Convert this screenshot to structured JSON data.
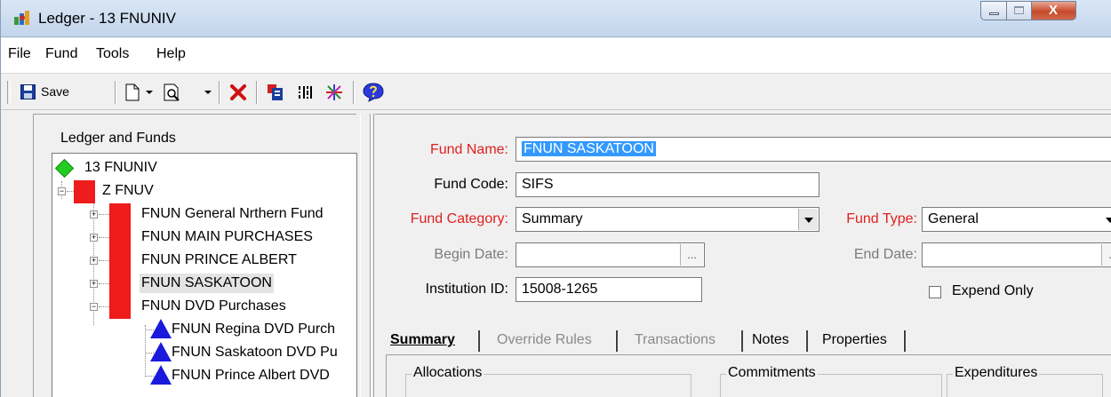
{
  "window": {
    "title": "Ledger - 13 FNUNIV",
    "close_glyph": "X"
  },
  "menu": {
    "items": [
      "File",
      "Fund",
      "Tools",
      "Help"
    ]
  },
  "toolbar": {
    "save_label": "Save",
    "icons": [
      "save-icon",
      "new-document-icon",
      "print-preview-icon",
      "delete-icon",
      "report-icon",
      "barcode-icon",
      "asterisk-icon",
      "help-icon"
    ]
  },
  "tree": {
    "header": "Ledger and Funds",
    "root": "13 FNUNIV",
    "ledger": "Z FNUV",
    "funds": [
      "FNUN General Nrthern Fund",
      "FNUN MAIN PURCHASES",
      "FNUN PRINCE ALBERT",
      "FNUN SASKATOON",
      "FNUN DVD Purchases"
    ],
    "subfunds": [
      "FNUN Regina DVD Purch",
      "FNUN Saskatoon DVD Pu",
      "FNUN Prince Albert DVD"
    ],
    "expand_glyph": "+",
    "collapse_glyph": "−"
  },
  "form": {
    "fund_name_label": "Fund Name:",
    "fund_name_value": "FNUN SASKATOON",
    "fund_code_label": "Fund Code:",
    "fund_code_value": "SIFS",
    "fund_category_label": "Fund Category:",
    "fund_category_value": "Summary",
    "fund_type_label": "Fund Type:",
    "fund_type_value": "General",
    "begin_date_label": "Begin Date:",
    "begin_date_value": "",
    "end_date_label": "End Date:",
    "end_date_value": "",
    "institution_label": "Institution ID:",
    "institution_value": "15008-1265",
    "expend_only_label": "Expend Only",
    "ellipsis": "...",
    "colors": {
      "required_label": "#e02020",
      "disabled_label": "#7a7a7a",
      "selection": "#3399ff"
    }
  },
  "tabs": [
    {
      "label": "Summary",
      "state": "active"
    },
    {
      "label": "Override Rules",
      "state": "disabled"
    },
    {
      "label": "Transactions",
      "state": "disabled"
    },
    {
      "label": "Notes",
      "state": "enabled"
    },
    {
      "label": "Properties",
      "state": "enabled"
    }
  ],
  "groups": [
    "Allocations",
    "Commitments",
    "Expenditures"
  ]
}
